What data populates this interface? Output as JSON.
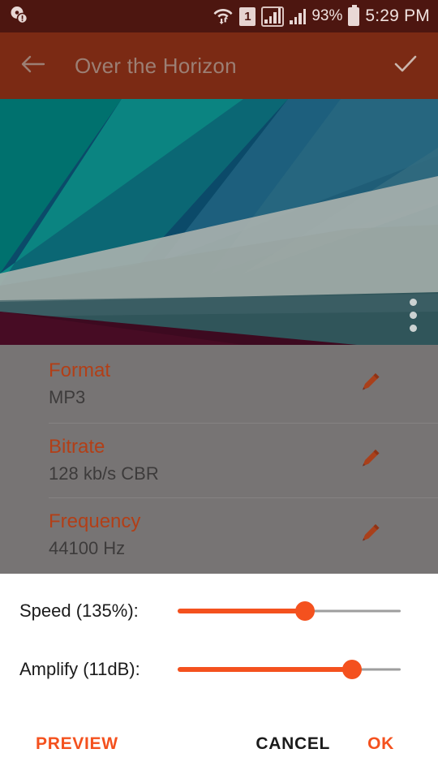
{
  "status_bar": {
    "notification_icon": "disc-warning-icon",
    "wifi_icon": "wifi-transfer-icon",
    "sim_label": "1",
    "signal_primary_icon": "signal-bars-boxed-icon",
    "signal_secondary_icon": "signal-bars-icon",
    "battery_percent": "93%",
    "battery_icon": "battery-full-icon",
    "time": "5:29 PM",
    "background_color": "#4d1610"
  },
  "app_bar": {
    "back_icon": "back-arrow-icon",
    "title": "Over the Horizon",
    "confirm_icon": "check-icon",
    "background_color": "#7b2a14",
    "title_color": "#9c7f74"
  },
  "artwork": {
    "alt": "abstract geometric album art",
    "overflow_icon": "overflow-menu-icon",
    "colors": {
      "teal": "#00716e",
      "deep_blue": "#0b4a69",
      "slate_blue": "#2a6074",
      "light_gray": "#a8b1ae",
      "dark_slate": "#2f4b50",
      "maroon": "#3d0a20"
    }
  },
  "details": {
    "rows": [
      {
        "label": "Format",
        "value": "MP3",
        "edit_icon": "pencil-icon"
      },
      {
        "label": "Bitrate",
        "value": "128 kb/s CBR",
        "edit_icon": "pencil-icon"
      },
      {
        "label": "Frequency",
        "value": "44100 Hz",
        "edit_icon": "pencil-icon"
      }
    ],
    "label_color": "#b23f17",
    "scrim_color": "#777474"
  },
  "dialog": {
    "sliders": [
      {
        "label": "Speed (135%):",
        "value": 135,
        "unit": "%",
        "fill_percent": 57
      },
      {
        "label": "Amplify (11dB):",
        "value": 11,
        "unit": "dB",
        "fill_percent": 78
      }
    ],
    "buttons": {
      "preview": "PREVIEW",
      "cancel": "CANCEL",
      "ok": "OK"
    },
    "accent_color": "#f4511e",
    "background_color": "#ffffff"
  }
}
